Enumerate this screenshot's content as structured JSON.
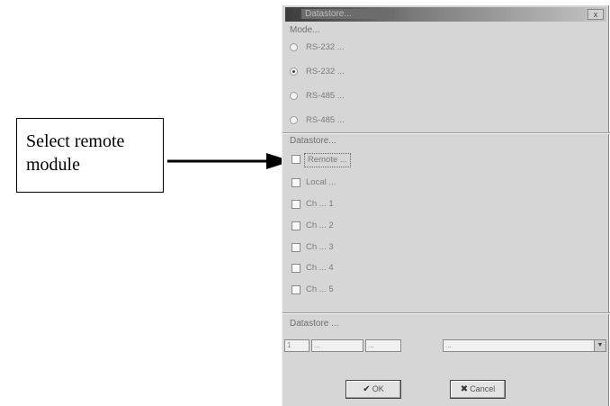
{
  "callout": {
    "line1": "Select remote",
    "line2": "module"
  },
  "dialog": {
    "title": "Datastore...",
    "close": "x",
    "section1": "Mode...",
    "radios": [
      {
        "label": "RS-232 ...",
        "selected": false
      },
      {
        "label": "RS-232 ...",
        "selected": true
      },
      {
        "label": "RS-485 ...",
        "selected": false
      },
      {
        "label": "RS-485 ...",
        "selected": false
      }
    ],
    "section2": "Datastore...",
    "checks": [
      {
        "label": "Remote ...",
        "focused": true
      },
      {
        "label": "Local ...",
        "focused": false
      },
      {
        "label": "Ch ... 1",
        "focused": false
      },
      {
        "label": "Ch ... 2",
        "focused": false
      },
      {
        "label": "Ch ... 3",
        "focused": false
      },
      {
        "label": "Ch ... 4",
        "focused": false
      },
      {
        "label": "Ch ... 5",
        "focused": false
      }
    ],
    "section3": "Datastore ...",
    "fields": [
      "1",
      "...",
      "...",
      "..."
    ],
    "ok_label": "OK",
    "cancel_label": "Cancel",
    "ok_icon": "check-icon",
    "cancel_icon": "x-icon"
  }
}
